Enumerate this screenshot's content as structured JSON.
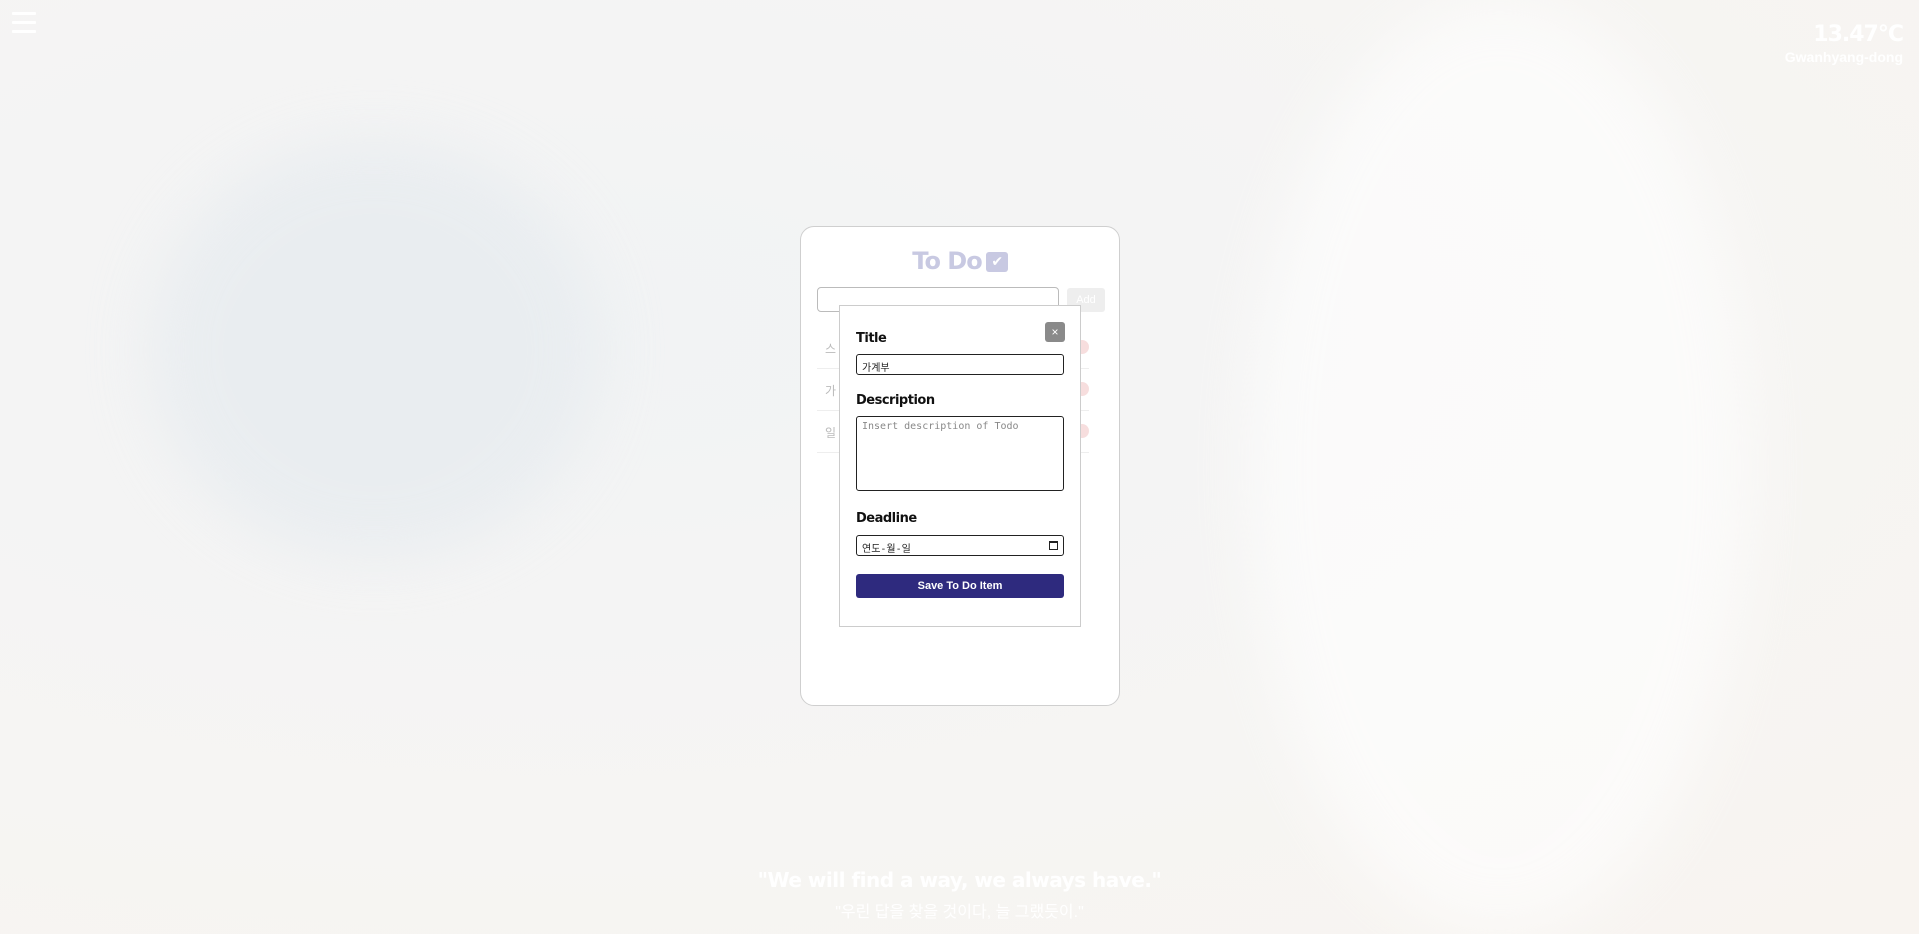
{
  "menu": {
    "icon": "hamburger-icon"
  },
  "weather": {
    "temperature": "13.47°C",
    "location": "Gwanhyang-dong"
  },
  "todo": {
    "title": "To Do",
    "check_icon": "check-icon",
    "add_button": "Add",
    "items": [
      {
        "text": "스"
      },
      {
        "text": "가"
      },
      {
        "text": "일"
      }
    ]
  },
  "modal": {
    "close_label": "×",
    "title_label": "Title",
    "title_value": "가계부",
    "description_label": "Description",
    "description_placeholder": "Insert description of Todo",
    "deadline_label": "Deadline",
    "deadline_value": "연도-월-일",
    "save_button": "Save To Do Item"
  },
  "quote": {
    "english": "\"We will find a way, we always have.\"",
    "korean": "\"우린 답을 찾을 것이다, 늘 그랬듯이.\""
  }
}
